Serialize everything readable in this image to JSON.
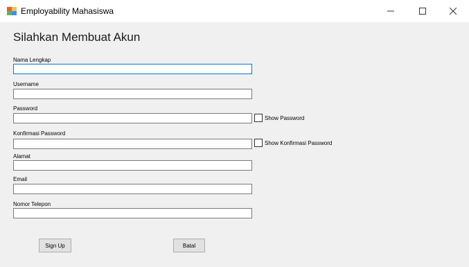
{
  "window": {
    "title": "Employability Mahasiswa",
    "icon": "app-window-icon",
    "controls": [
      "minimize-icon",
      "maximize-icon",
      "close-icon"
    ]
  },
  "form": {
    "heading": "Silahkan Membuat Akun",
    "fields": {
      "nama_lengkap": {
        "label": "Nama Lengkap",
        "value": ""
      },
      "username": {
        "label": "Username",
        "value": ""
      },
      "password": {
        "label": "Password",
        "value": ""
      },
      "konfirmasi_password": {
        "label": "Konfirmasi Password",
        "value": ""
      },
      "alamat": {
        "label": "Alamat",
        "value": ""
      },
      "email": {
        "label": "Email",
        "value": ""
      },
      "nomor_telepon": {
        "label": "Nomor Telepon",
        "value": ""
      }
    },
    "checkboxes": {
      "show_password": {
        "label": "Show Password",
        "checked": false
      },
      "show_konfirmasi_password": {
        "label": "Show Konfirmasi Password",
        "checked": false
      }
    },
    "buttons": {
      "sign_up": "Sign Up",
      "batal": "Batal"
    }
  },
  "colors": {
    "form_background": "#f0f0f0",
    "focus_border": "#0078d7",
    "input_border": "#7a7a7a"
  }
}
